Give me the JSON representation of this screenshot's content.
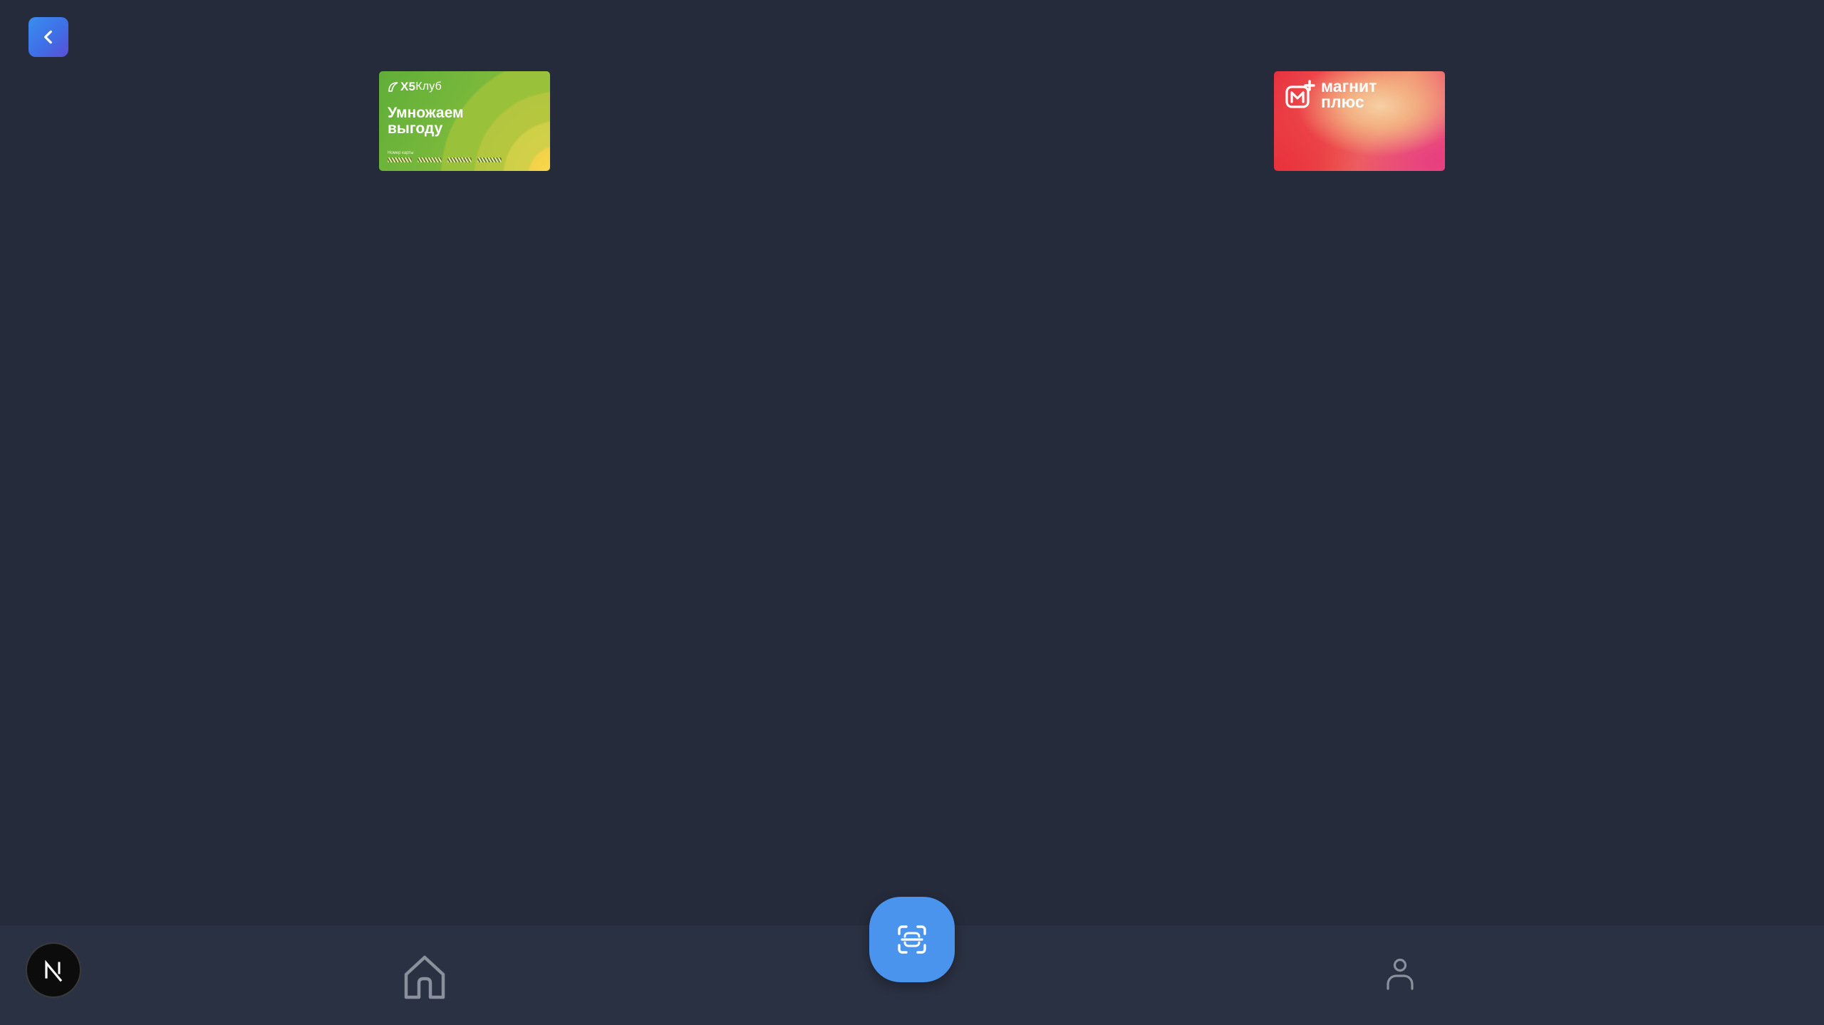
{
  "header": {
    "back_icon": "chevron-left-icon"
  },
  "cards": [
    {
      "brand": "X5 Клуб",
      "logo_mark": "X5",
      "logo_word": "Клуб",
      "slogan": "Умножаем выгоду",
      "number_label": "Номер карты",
      "colors": [
        "#5fae3a",
        "#9cc23a",
        "#ffd84a"
      ]
    },
    {
      "brand": "магнит плюс",
      "name": "магнит плюс",
      "colors": [
        "#e8323f",
        "#f3b082",
        "#e9457c"
      ]
    }
  ],
  "bottom_nav": {
    "logo_letter": "N",
    "items": [
      {
        "name": "home",
        "icon": "home-icon"
      },
      {
        "name": "scan",
        "icon": "scan-icon"
      },
      {
        "name": "profile",
        "icon": "user-icon"
      }
    ]
  },
  "colors": {
    "background": "#252b3b",
    "bottom_bar": "#2a3142",
    "accent": "#4a94ee"
  }
}
